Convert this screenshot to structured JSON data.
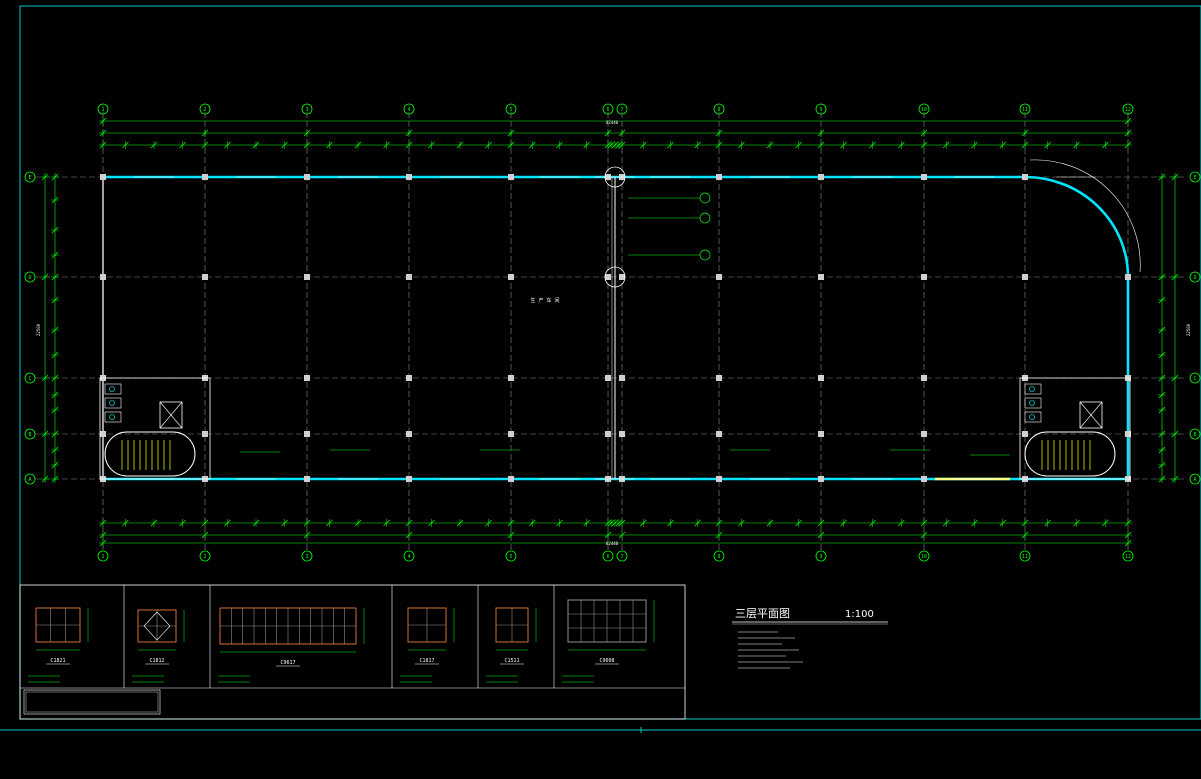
{
  "colors": {
    "background": "#000000",
    "frame": "#00c8c8",
    "wall": "#00e5ff",
    "grid": "#8a8a8a",
    "dimension": "#00ff00",
    "text": "#ffffff",
    "column": "#d0d0d0",
    "detail_frame": "#d07030",
    "note_text": "#00ff00",
    "stair": "#e0e000",
    "door": "#ffff80"
  },
  "axes": {
    "columns": [
      "1",
      "2",
      "3",
      "4",
      "5",
      "6",
      "7",
      "8",
      "9",
      "10",
      "11",
      "12"
    ],
    "rows": [
      "E",
      "D",
      "C",
      "B",
      "A"
    ]
  },
  "drawing": {
    "title": "三层平面图",
    "scale": "1:100",
    "total_length": "82440",
    "total_width": "22500",
    "room_name": "生 产 车 间"
  },
  "details": [
    {
      "name": "C1821"
    },
    {
      "name": "C1812"
    },
    {
      "name": "C9617"
    },
    {
      "name": "C1817"
    },
    {
      "name": "C1511"
    },
    {
      "name": "C9608"
    }
  ]
}
